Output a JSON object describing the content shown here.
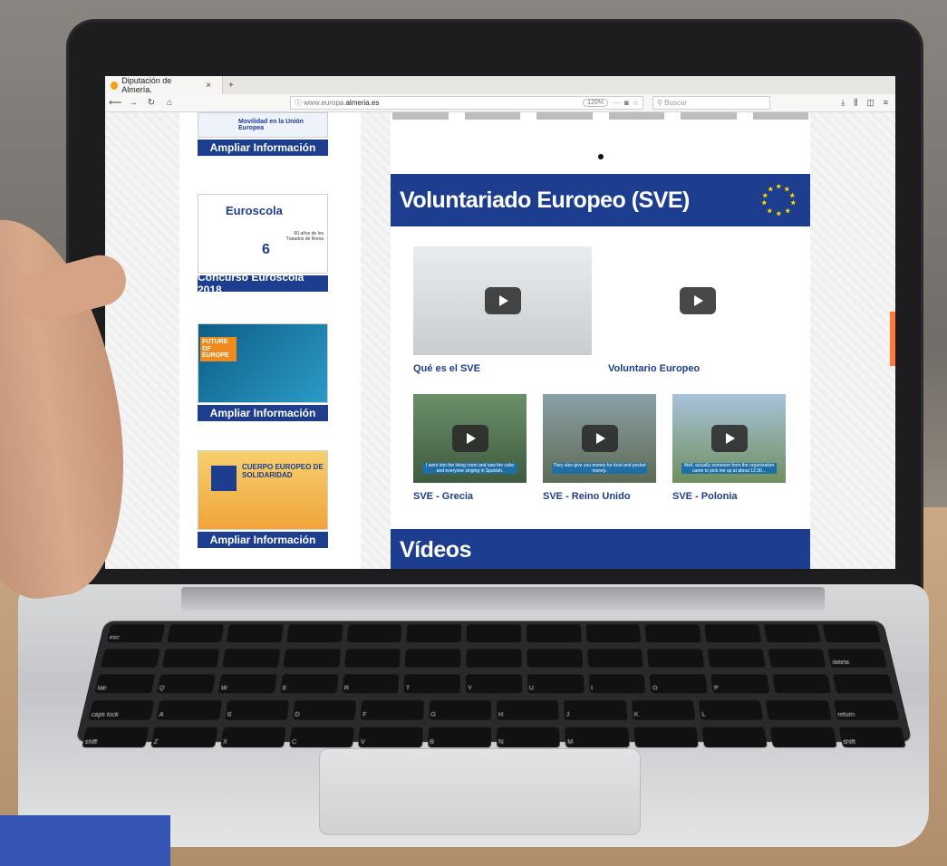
{
  "browser": {
    "tab_title": "Diputación de Almería. ",
    "tab_close": "×",
    "new_tab": "+",
    "url_prefix": "www.europa.",
    "url_domain": "almeria.es",
    "zoom": "120%",
    "search_placeholder": "Buscar"
  },
  "sidebar": {
    "top_caption": "Movilidad en la Unión Europea",
    "cards": [
      {
        "button": "Ampliar Información"
      },
      {
        "title": "Euroscola",
        "subtitle": "60 años de los Tratados de Roma",
        "button": "Concurso Euroscola  2018"
      },
      {
        "label": "FUTURE OF EUROPE",
        "button": "Ampliar Información"
      },
      {
        "label": "CUERPO EUROPEO DE SOLIDARIDAD",
        "button": "Ampliar Información"
      }
    ]
  },
  "main": {
    "section_title": "Voluntariado Europeo (SVE)",
    "videos": [
      {
        "caption": "Qué es el SVE"
      },
      {
        "caption": "Voluntario Europeo"
      },
      {
        "caption": "SVE - Grecia",
        "subtitle": "I went into the living room and saw the cake and everyone singing in Spanish."
      },
      {
        "caption": "SVE - Reino Unido",
        "subtitle": "They also give you money for food and pocket money."
      },
      {
        "caption": "SVE - Polonia",
        "subtitle": "Well, actually someone from the organization came to pick me up at about 12:30..."
      }
    ],
    "next_section_title": "Vídeos"
  },
  "colors": {
    "eu_blue": "#1d3d8f",
    "accent_orange": "#ff7a3d"
  }
}
